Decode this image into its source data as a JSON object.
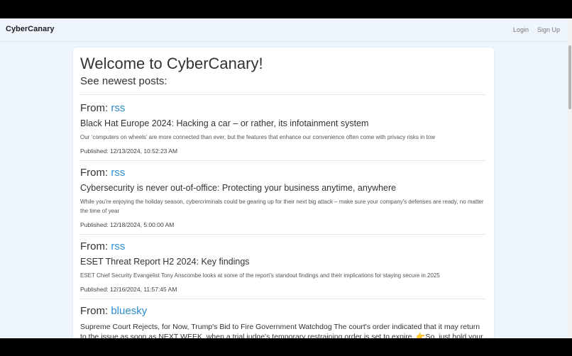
{
  "navbar": {
    "brand": "CyberCanary",
    "login_label": "Login",
    "signup_label": "Sign Up"
  },
  "main": {
    "welcome": "Welcome to CyberCanary!",
    "subtitle": "See newest posts:",
    "from_label": "From:",
    "posts": [
      {
        "source": "rss",
        "title": "Black Hat Europe 2024: Hacking a car – or rather, its infotainment system",
        "description": "Our ‘computers on wheels’ are more connected than ever, but the features that enhance our convenience often come with privacy risks in tow",
        "published": "Published: 12/13/2024, 10:52:23 AM"
      },
      {
        "source": "rss",
        "title": "Cybersecurity is never out-of-office: Protecting your business anytime, anywhere",
        "description": "While you're enjoying the holiday season, cybercriminals could be gearing up for their next big attack – make sure your company's defenses are ready, no matter the time of year",
        "published": "Published: 12/18/2024, 5:00:00 AM"
      },
      {
        "source": "rss",
        "title": "ESET Threat Report H2 2024: Key findings",
        "description": "ESET Chief Security Evangelist Tony Anscombe looks at some of the report's standout findings and their implications for staying secure in 2025",
        "published": "Published: 12/16/2024, 11:57:45 AM"
      },
      {
        "source": "bluesky",
        "text": "Supreme Court Rejects, for Now, Trump's Bid to Fire Government Watchdog The court's order indicated that it may return to the issue as soon as NEXT WEEK, when a trial judge's temporary restraining order is set to expire. 👉So, just hold your"
      }
    ]
  },
  "colors": {
    "page_background": "#eef5fc",
    "link": "#2f8ccc",
    "text": "#333333"
  }
}
